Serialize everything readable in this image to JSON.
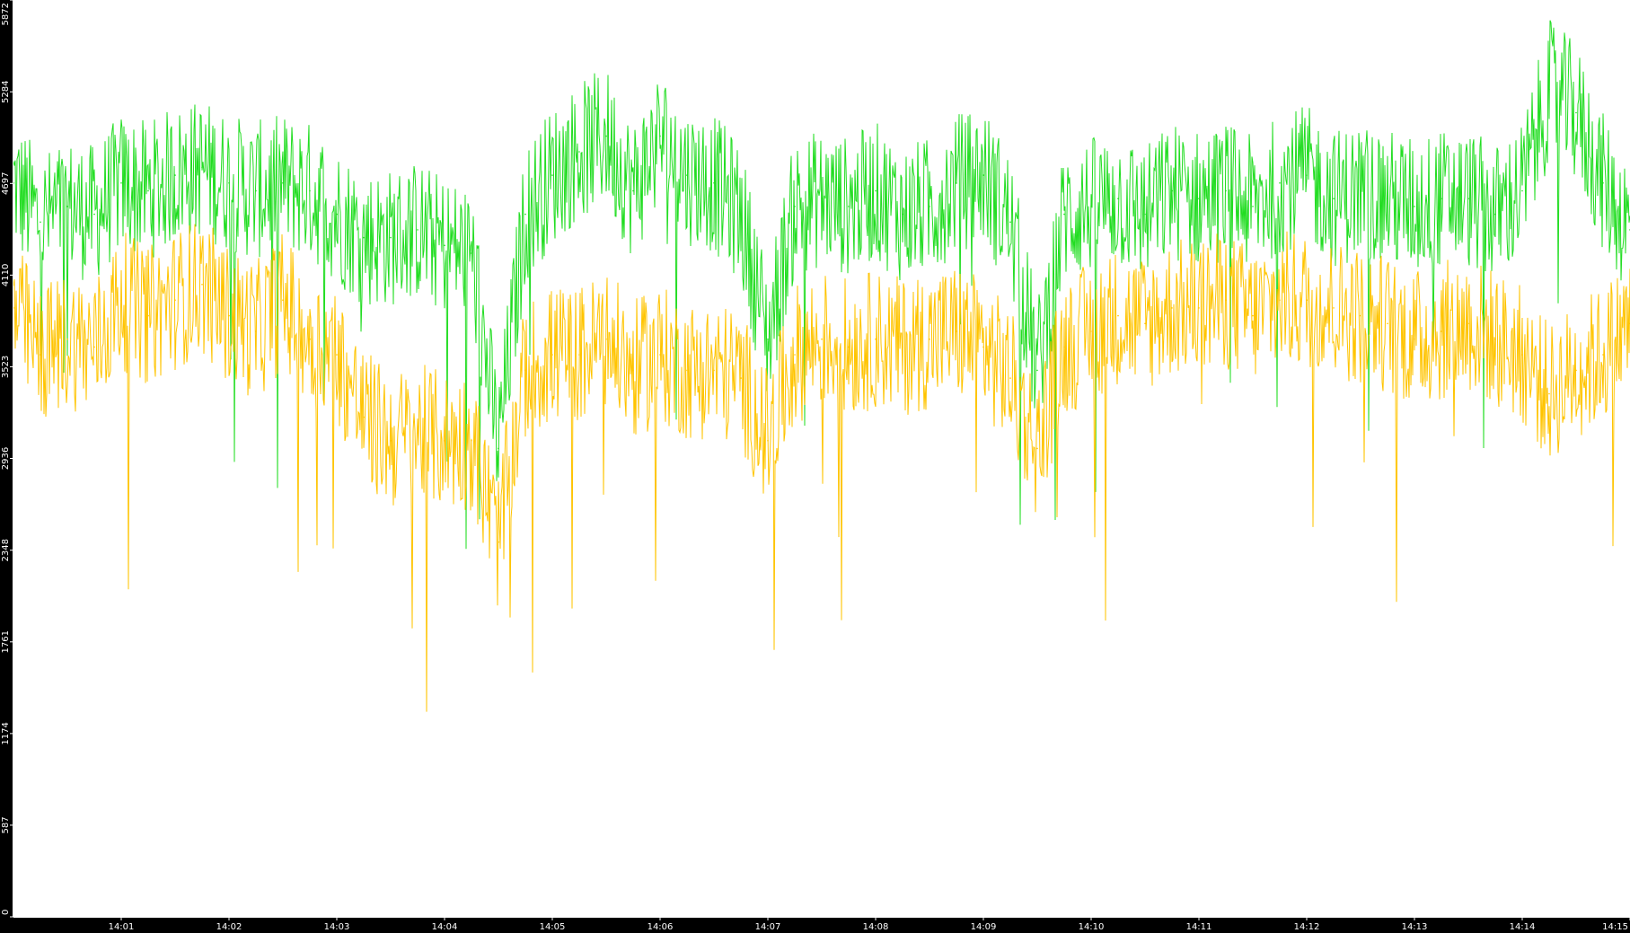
{
  "chart_data": {
    "type": "line",
    "title": "",
    "xlabel": "",
    "ylabel": "",
    "ylim": [
      0,
      5872
    ],
    "y_ticks": [
      "0",
      "587",
      "1174",
      "1761",
      "2348",
      "2936",
      "3523",
      "4110",
      "4697",
      "5284",
      "5872"
    ],
    "x_ticks": [
      "14:01",
      "14:02",
      "14:03",
      "14:04",
      "14:05",
      "14:06",
      "14:07",
      "14:08",
      "14:09",
      "14:10",
      "14:11",
      "14:12",
      "14:13",
      "14:14",
      "14:15"
    ],
    "x_range": [
      "14:00:00",
      "14:15:00"
    ],
    "grid": false,
    "legend": "none",
    "background": "#ffffff",
    "series": [
      {
        "color": "#22dd22",
        "x": [
          "14:00:00",
          "14:00:15",
          "14:00:30",
          "14:00:45",
          "14:01:00",
          "14:01:15",
          "14:01:30",
          "14:01:45",
          "14:02:00",
          "14:02:15",
          "14:02:30",
          "14:02:45",
          "14:03:00",
          "14:03:15",
          "14:03:30",
          "14:03:45",
          "14:04:00",
          "14:04:15",
          "14:04:30",
          "14:04:45",
          "14:05:00",
          "14:05:15",
          "14:05:30",
          "14:05:45",
          "14:06:00",
          "14:06:15",
          "14:06:30",
          "14:06:45",
          "14:07:00",
          "14:07:15",
          "14:07:30",
          "14:07:45",
          "14:08:00",
          "14:08:15",
          "14:08:30",
          "14:08:45",
          "14:09:00",
          "14:09:15",
          "14:09:30",
          "14:09:45",
          "14:10:00",
          "14:10:15",
          "14:10:30",
          "14:10:45",
          "14:11:00",
          "14:11:15",
          "14:11:30",
          "14:11:45",
          "14:12:00",
          "14:12:15",
          "14:12:30",
          "14:12:45",
          "14:13:00",
          "14:13:15",
          "14:13:30",
          "14:13:45",
          "14:14:00",
          "14:14:15",
          "14:14:30",
          "14:14:45",
          "14:15:00"
        ],
        "values": [
          4700,
          4450,
          4550,
          4500,
          4700,
          4650,
          4750,
          4800,
          4700,
          4650,
          4700,
          4650,
          4500,
          4350,
          4350,
          4400,
          4300,
          4250,
          3000,
          4500,
          4750,
          4900,
          5000,
          4650,
          5000,
          4750,
          4700,
          4500,
          3700,
          4550,
          4600,
          4550,
          4650,
          4500,
          4550,
          4700,
          4750,
          4450,
          3500,
          4500,
          4550,
          4600,
          4500,
          4650,
          4600,
          4650,
          4550,
          4700,
          4750,
          4600,
          4650,
          4600,
          4550,
          4600,
          4600,
          4500,
          4650,
          5300,
          5150,
          4700,
          4400
        ]
      },
      {
        "color": "#ffc400",
        "x": [
          "14:00:00",
          "14:00:15",
          "14:00:30",
          "14:00:45",
          "14:01:00",
          "14:01:15",
          "14:01:30",
          "14:01:45",
          "14:02:00",
          "14:02:15",
          "14:02:30",
          "14:02:45",
          "14:03:00",
          "14:03:15",
          "14:03:30",
          "14:03:45",
          "14:04:00",
          "14:04:15",
          "14:04:30",
          "14:04:45",
          "14:05:00",
          "14:05:15",
          "14:05:30",
          "14:05:45",
          "14:06:00",
          "14:06:15",
          "14:06:30",
          "14:06:45",
          "14:07:00",
          "14:07:15",
          "14:07:30",
          "14:07:45",
          "14:08:00",
          "14:08:15",
          "14:08:30",
          "14:08:45",
          "14:09:00",
          "14:09:15",
          "14:09:30",
          "14:09:45",
          "14:10:00",
          "14:10:15",
          "14:10:30",
          "14:10:45",
          "14:11:00",
          "14:11:15",
          "14:11:30",
          "14:11:45",
          "14:12:00",
          "14:12:15",
          "14:12:30",
          "14:12:45",
          "14:13:00",
          "14:13:15",
          "14:13:30",
          "14:13:45",
          "14:14:00",
          "14:14:15",
          "14:14:30",
          "14:14:45",
          "14:15:00"
        ],
        "values": [
          3900,
          3600,
          3700,
          3650,
          3950,
          3850,
          3950,
          4050,
          3850,
          3750,
          3950,
          3700,
          3600,
          3200,
          3050,
          3100,
          3050,
          3050,
          2400,
          3500,
          3600,
          3600,
          3700,
          3500,
          3600,
          3500,
          3500,
          3450,
          3050,
          3600,
          3700,
          3650,
          3700,
          3650,
          3700,
          3750,
          3650,
          3450,
          3000,
          3650,
          3750,
          3850,
          3800,
          3900,
          3900,
          3950,
          3850,
          3950,
          3950,
          3900,
          3850,
          3800,
          3700,
          3750,
          3800,
          3700,
          3600,
          3350,
          3500,
          3600,
          3800
        ]
      }
    ]
  }
}
